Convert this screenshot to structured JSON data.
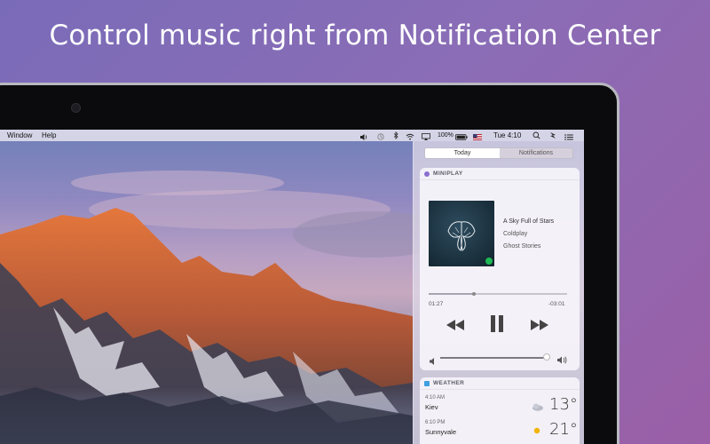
{
  "headline": "Control music right from Notification Center",
  "menubar": {
    "left_items": [
      "Window",
      "Help"
    ],
    "battery": "100%",
    "clock": "Tue 4:10"
  },
  "notification_center": {
    "tabs": [
      {
        "label": "Today",
        "selected": true
      },
      {
        "label": "Notifications",
        "selected": false
      }
    ],
    "miniplay": {
      "title": "MINIPLAY",
      "track_title": "A Sky Full of Stars",
      "artist": "Coldplay",
      "album": "Ghost Stories",
      "elapsed": "01:27",
      "remaining": "-03:01",
      "progress_fraction": 0.33,
      "volume_fraction": 0.97,
      "accent": "#8a6fd0",
      "controls": [
        "rewind-icon",
        "pause-icon",
        "fast-forward-icon"
      ]
    },
    "weather": {
      "title": "WEATHER",
      "rows": [
        {
          "time": "4:10 AM",
          "city": "Kiev",
          "temp": "13°",
          "icon": "cloudy-night-icon"
        },
        {
          "time": "6:10 PM",
          "city": "Sunnyvale",
          "temp": "21°",
          "icon": "sun-icon"
        }
      ]
    }
  },
  "colors": {
    "background_start": "#7a6bb8",
    "background_end": "#9a5fa6",
    "spotify_green": "#1db954",
    "weather_icon": "#3f9fe0"
  }
}
